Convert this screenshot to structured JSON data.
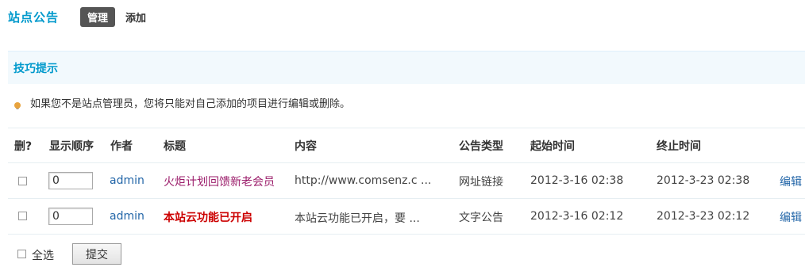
{
  "header": {
    "title": "站点公告",
    "tabs": [
      {
        "label": "管理",
        "active": true
      },
      {
        "label": "添加",
        "active": false
      }
    ]
  },
  "tips": {
    "heading": "技巧提示",
    "text": "如果您不是站点管理员，您将只能对自己添加的项目进行编辑或删除。"
  },
  "table": {
    "columns": [
      "删?",
      "显示顺序",
      "作者",
      "标题",
      "内容",
      "公告类型",
      "起始时间",
      "终止时间"
    ],
    "rows": [
      {
        "order": "0",
        "author": "admin",
        "title": "火炬计划回馈新老会员",
        "content": "http://www.comsenz.c ...",
        "type": "网址链接",
        "start": "2012-3-16 02:38",
        "end": "2012-3-23 02:38",
        "action": "编辑"
      },
      {
        "order": "0",
        "author": "admin",
        "title": "本站云功能已开启",
        "content": "本站云功能已开启，要  ...",
        "type": "文字公告",
        "start": "2012-3-16 02:12",
        "end": "2012-3-23 02:12",
        "action": "编辑"
      }
    ]
  },
  "footer": {
    "select_all": "全选",
    "submit": "提交"
  },
  "colors": {
    "accent": "#0099cc",
    "link": "#2366a8",
    "title_red": "#cc0000",
    "title_purple": "#9b1c6a"
  }
}
